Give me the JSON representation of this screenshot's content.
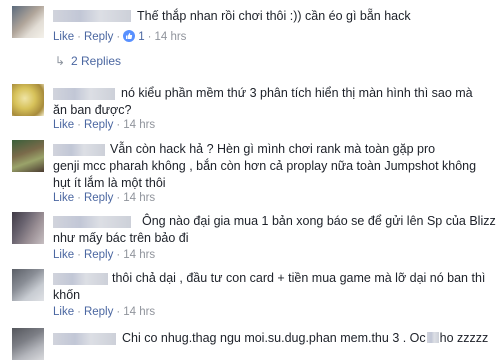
{
  "actions": {
    "like": "Like",
    "reply": "Reply",
    "separator": "·"
  },
  "reply_toggle": {
    "label": "2 Replies"
  },
  "comments": [
    {
      "lines": [
        "Thế thắp nhan rồi chơi thôi :)) cần éo gì bẵn hack"
      ],
      "reaction_count": "1",
      "time": "14 hrs",
      "avatar_colors": [
        "#5b6b7d",
        "#b0a59a",
        "#e2ddd5",
        "#f4f1ea"
      ]
    },
    {
      "lines": [
        "nó kiểu phần mềm thứ 3 phân tích hiển thị màn hình thì sao mà",
        "ăn ban được?"
      ],
      "time": "14 hrs",
      "avatar_colors": [
        "#d7c25a",
        "#efe4a6",
        "#a78b3c",
        "#f7f1d2"
      ]
    },
    {
      "lines": [
        "Vẫn còn hack hả ? Hèn gì mình chơi rank mà toàn gặp pro",
        "genji mcc pharah không , bắn còn hơn cả proplay nữa toàn Jumpshot không",
        "hụt ít lắm là một thôi"
      ],
      "time": "14 hrs",
      "avatar_colors": [
        "#3a5f3a",
        "#7a6a4a",
        "#9aa36a",
        "#4a3a30"
      ]
    },
    {
      "lines": [
        "Ông nào đại gia mua 1 bản xong báo se để gửi lên Sp của Blizz",
        "như mấy bác trên bảo đi"
      ],
      "time": "14 hrs",
      "avatar_colors": [
        "#6a6470",
        "#9a8f95",
        "#c7bfc2",
        "#3f3a45"
      ]
    },
    {
      "lines": [
        "thôi chả dại , đầu tư con card + tiền mua game mà lỡ dại nó ban thì",
        "khốn"
      ],
      "time": "14 hrs",
      "avatar_colors": [
        "#8a8e96",
        "#c8ccd2",
        "#5a5e66",
        "#e0e2e6"
      ]
    },
    {
      "lines": [
        "Chi co nhug.thag ngu moi.su.dug.phan mem.thu 3 . Oc",
        "ho zzzzz"
      ],
      "time": "",
      "avatar_colors": [
        "#7d7f86",
        "#b4b6bc",
        "#54565c",
        "#d9dadd"
      ]
    }
  ]
}
